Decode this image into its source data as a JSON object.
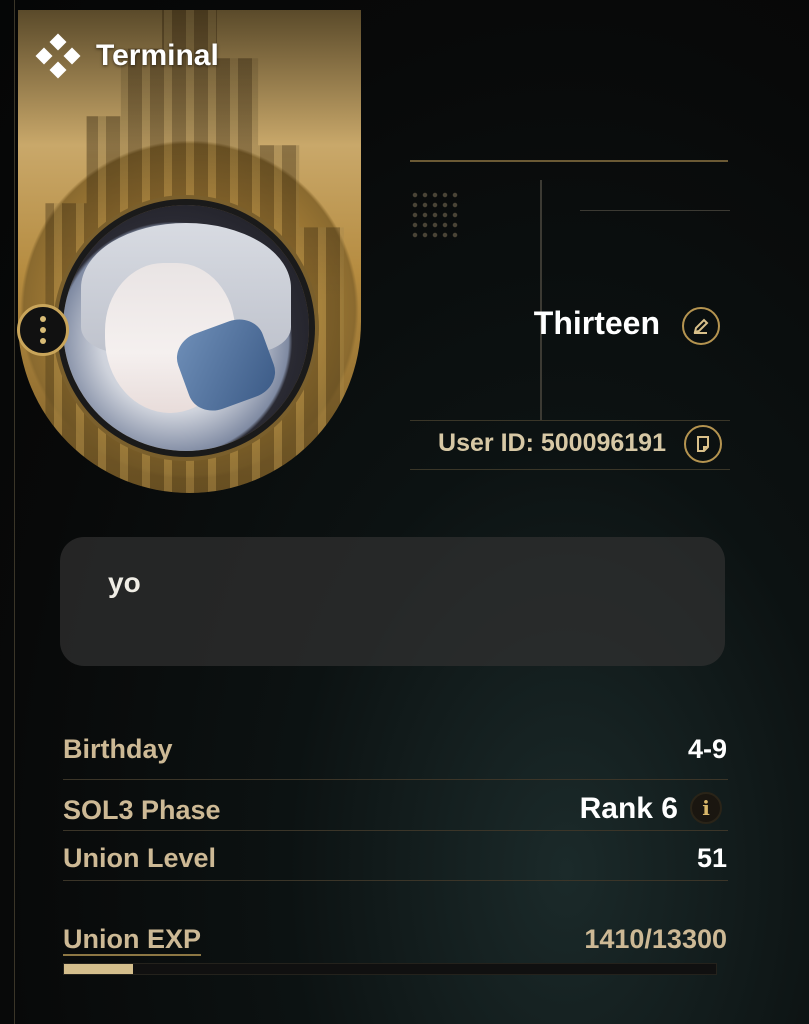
{
  "colors": {
    "accent": "#c9a55a",
    "panel": "#303030",
    "label": "#cdb995"
  },
  "header": {
    "title": "Terminal",
    "icon": "four-diamonds-icon"
  },
  "profile": {
    "username": "Thirteen",
    "edit_icon": "pencil-icon",
    "user_id": "User ID: 500096191",
    "copy_icon": "copy-icon",
    "menu_icon": "more-vertical-icon",
    "bio": "yo"
  },
  "stats": [
    {
      "label": "Birthday",
      "value": "4-9"
    },
    {
      "label": "SOL3 Phase",
      "value": "Rank 6",
      "info_icon": "info-icon"
    },
    {
      "label": "Union Level",
      "value": "51"
    }
  ],
  "union_exp": {
    "label": "Union EXP",
    "value": "1410/13300",
    "progress": 0.106
  }
}
